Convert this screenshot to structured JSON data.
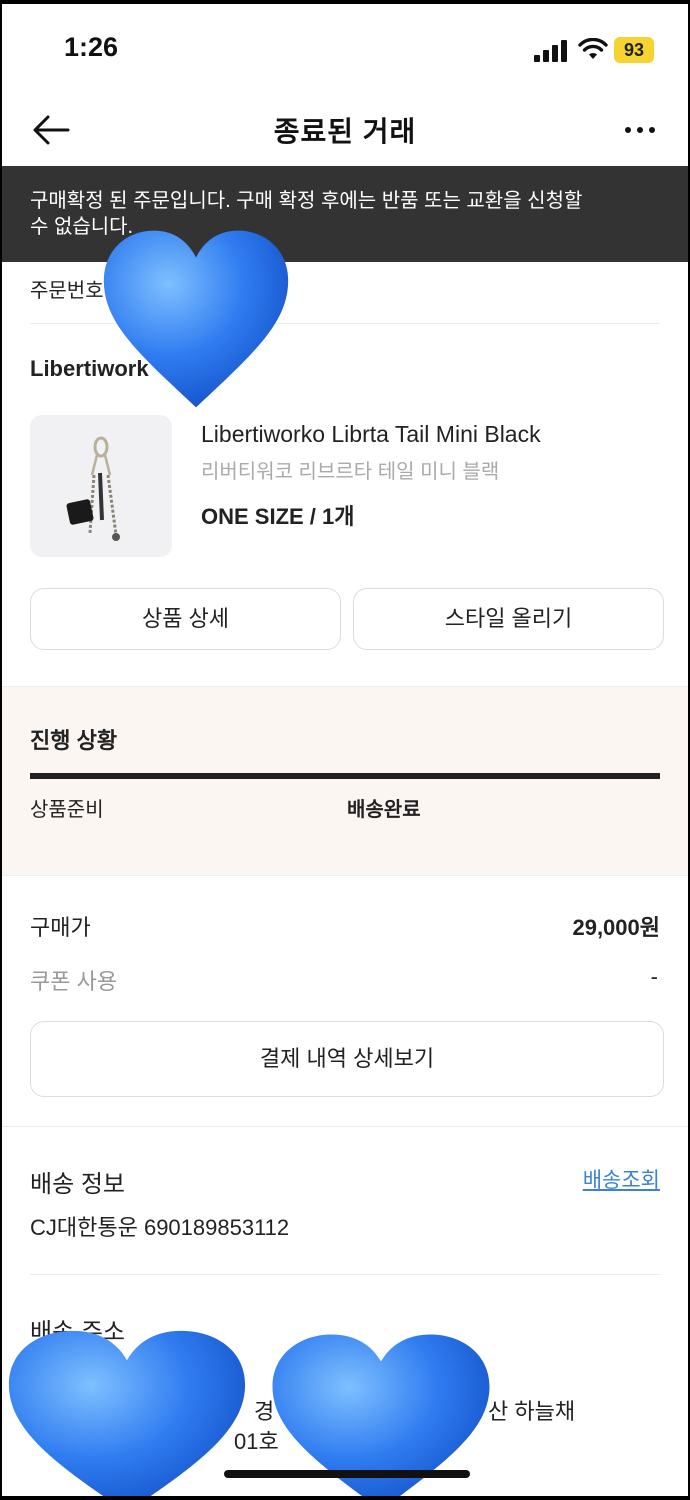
{
  "status_bar": {
    "time": "1:26",
    "battery": "93"
  },
  "header": {
    "title": "종료된 거래"
  },
  "notice": {
    "text": "구매확정 된 주문입니다. 구매 확정 후에는 반품 또는 교환을 신청할 수 없습니다."
  },
  "order": {
    "label": "주문번호"
  },
  "brand": "Libertiwork",
  "product": {
    "name": "Libertiworko Librta Tail Mini Black",
    "name_ko": "리버티워코 리브르타 테일 미니 블랙",
    "option": "ONE SIZE / 1개"
  },
  "buttons": {
    "detail": "상품 상세",
    "style": "스타일 올리기",
    "payment": "결제 내역 상세보기"
  },
  "progress": {
    "title": "진행 상황",
    "step1": "상품준비",
    "step2": "배송완료",
    "fill": 1.0
  },
  "price": {
    "label": "구매가",
    "value": "29,000원",
    "coupon_label": "쿠폰 사용",
    "coupon_value": "-"
  },
  "shipping": {
    "title": "배송 정보",
    "track": "배송조회",
    "number": "CJ대한통운 690189853112"
  },
  "address": {
    "title": "배송 주소",
    "line1a": "경",
    "line1b": "산 하늘채",
    "line2": "01호"
  },
  "colors": {
    "heart": "#2f7cf0",
    "notice_bg": "#333333",
    "progress_bg": "#fcf6f3",
    "link": "#3b82d6"
  }
}
